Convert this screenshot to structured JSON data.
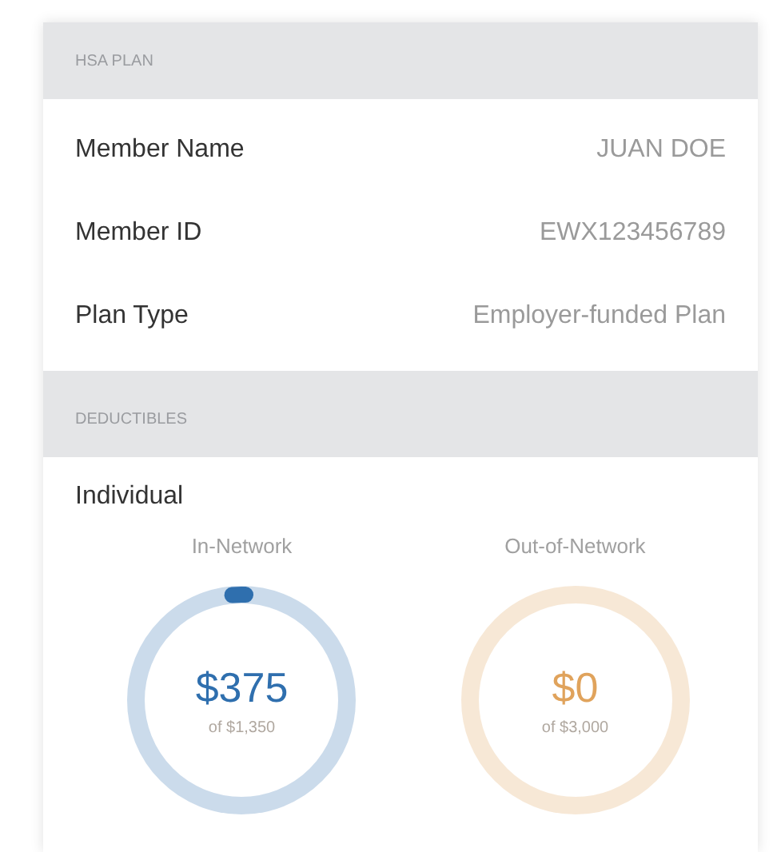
{
  "plan": {
    "header": "HSA PLAN",
    "rows": [
      {
        "label": "Member Name",
        "value": "JUAN DOE"
      },
      {
        "label": "Member ID",
        "value": "EWX123456789"
      },
      {
        "label": "Plan Type",
        "value": "Employer-funded Plan"
      }
    ]
  },
  "deductibles": {
    "header": "DEDUCTIBLES",
    "group": "Individual",
    "meters": [
      {
        "label": "In-Network",
        "amount": "$375",
        "limit": "of $1,350",
        "level": 0.02,
        "color": "#2f6fae"
      },
      {
        "label": "Out-of-Network",
        "amount": "$0",
        "limit": "of $3,000",
        "level": 0,
        "color": "#e0a35c"
      }
    ]
  }
}
